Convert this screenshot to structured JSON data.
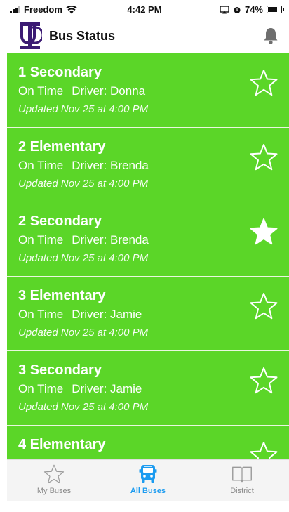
{
  "status_bar": {
    "carrier": "Freedom",
    "time": "4:42 PM",
    "battery": "74%",
    "battery_level": 0.74
  },
  "header": {
    "title": "Bus Status"
  },
  "icons": {
    "logo": "ud-logo-icon",
    "notifications": "bell-icon",
    "favorite": "star-icon",
    "bus": "bus-icon",
    "district": "book-icon"
  },
  "colors": {
    "card_green": "#5bd628",
    "accent_blue": "#1b9bf0",
    "logo_purple": "#3b1a73"
  },
  "buses": [
    {
      "name": "1 Secondary",
      "status": "On Time",
      "driver": "Driver: Donna",
      "updated": "Updated Nov 25 at 4:00 PM",
      "favorite": false
    },
    {
      "name": "2 Elementary",
      "status": "On Time",
      "driver": "Driver: Brenda",
      "updated": "Updated Nov 25 at 4:00 PM",
      "favorite": false
    },
    {
      "name": "2 Secondary",
      "status": "On Time",
      "driver": "Driver: Brenda",
      "updated": "Updated Nov 25 at 4:00 PM",
      "favorite": true
    },
    {
      "name": "3 Elementary",
      "status": "On Time",
      "driver": "Driver: Jamie",
      "updated": "Updated Nov 25 at 4:00 PM",
      "favorite": false
    },
    {
      "name": "3 Secondary",
      "status": "On Time",
      "driver": "Driver: Jamie",
      "updated": "Updated Nov 25 at 4:00 PM",
      "favorite": false
    },
    {
      "name": "4 Elementary",
      "status": "",
      "driver": "",
      "updated": "",
      "favorite": false
    }
  ],
  "tabs": [
    {
      "label": "My Buses",
      "active": false
    },
    {
      "label": "All Buses",
      "active": true
    },
    {
      "label": "District",
      "active": false
    }
  ]
}
